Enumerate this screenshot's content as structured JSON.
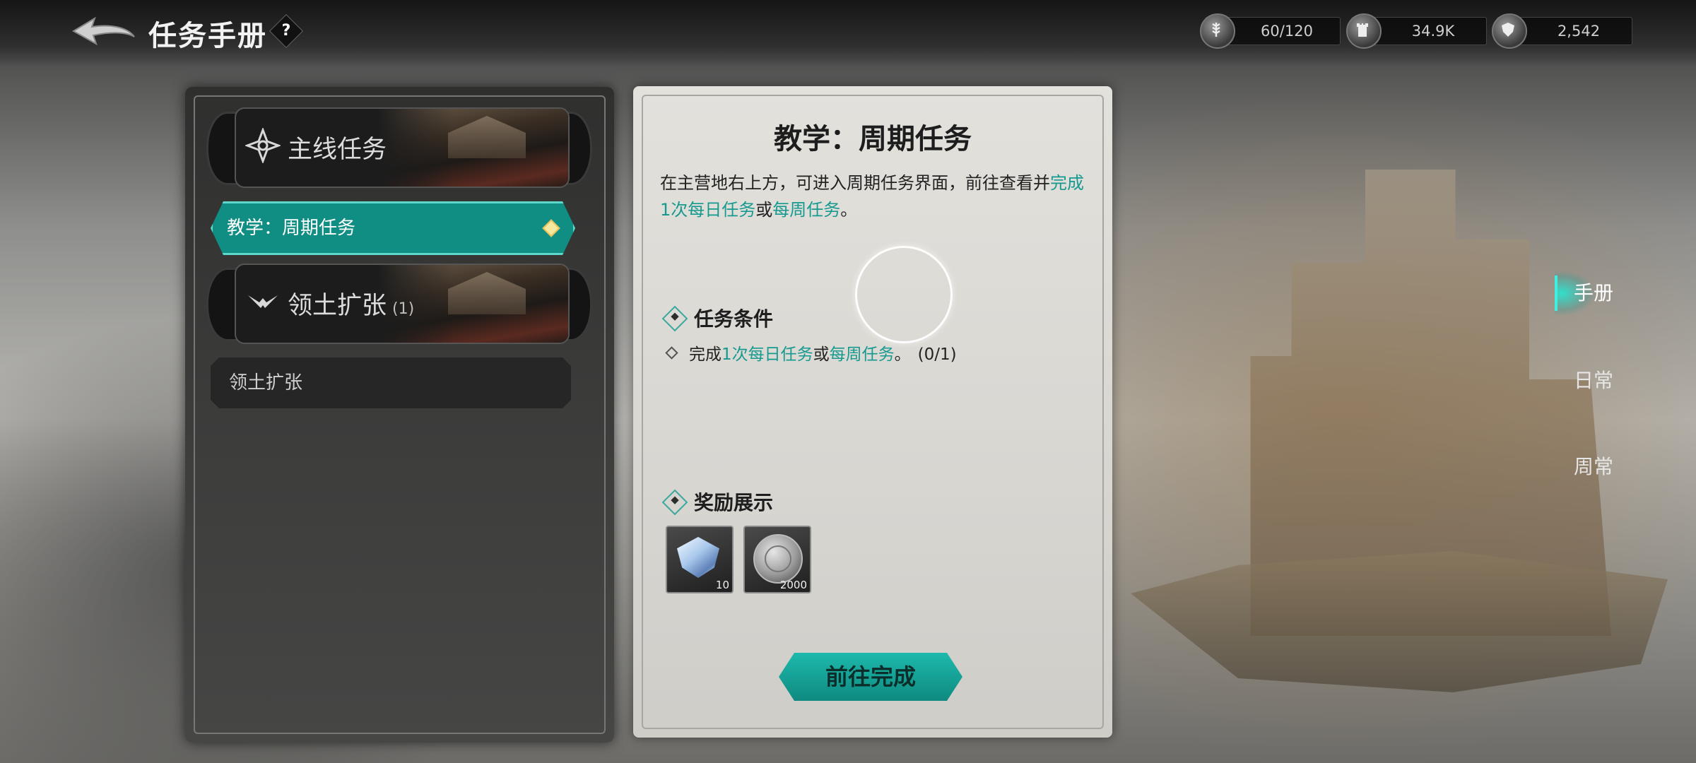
{
  "header": {
    "title": "任务手册",
    "help_label": "?"
  },
  "resources": [
    {
      "icon": "wheat-icon",
      "value": "60/120"
    },
    {
      "icon": "tower-icon",
      "value": "34.9K"
    },
    {
      "icon": "shield-icon",
      "value": "2,542"
    }
  ],
  "left_panel": {
    "categories": [
      {
        "label": "主线任务",
        "count": ""
      },
      {
        "label": "领土扩张",
        "count": "(1)"
      }
    ],
    "active_item": "教学：周期任务",
    "item": "领土扩张"
  },
  "quest": {
    "title": "教学：周期任务",
    "desc_prefix": "在主营地右上方，可进入周期任务界面，前往查看并",
    "desc_hl1": "完成1次每日任务",
    "desc_mid": "或",
    "desc_hl2": "每周任务",
    "desc_end": "。",
    "conditions_title": "任务条件",
    "cond_prefix": "完成",
    "cond_hl1": "1次每日任务",
    "cond_mid": "或",
    "cond_hl2": "每周任务",
    "cond_end": "。",
    "cond_progress": "(0/1)",
    "rewards_title": "奖励展示",
    "rewards": [
      {
        "icon": "crystal-gem-icon",
        "qty": "10"
      },
      {
        "icon": "silver-coin-icon",
        "qty": "2000"
      }
    ],
    "go_button": "前往完成"
  },
  "side_tabs": [
    "手册",
    "日常",
    "周常"
  ],
  "colors": {
    "accent": "#108e84",
    "highlight_text": "#169a90"
  }
}
